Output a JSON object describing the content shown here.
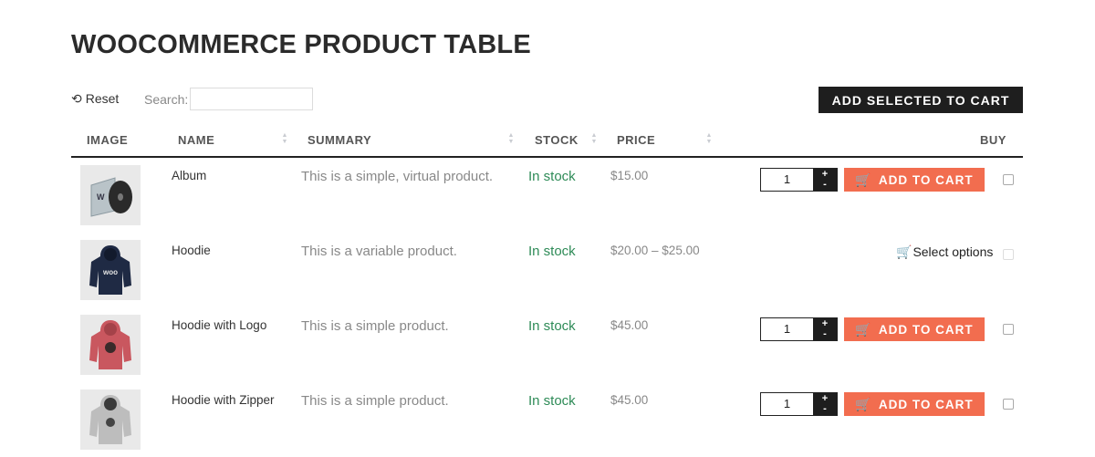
{
  "page": {
    "title": "WOOCOMMERCE PRODUCT TABLE"
  },
  "toolbar": {
    "reset_icon": "⟲",
    "reset_label": "Reset",
    "search_label": "Search:",
    "search_value": "",
    "add_selected_label": "ADD SELECTED TO CART"
  },
  "table": {
    "headers": {
      "image": "IMAGE",
      "name": "NAME",
      "summary": "SUMMARY",
      "stock": "STOCK",
      "price": "PRICE",
      "buy": "BUY"
    },
    "sort_icon": "sort-arrows-icon",
    "rows": [
      {
        "image": "album-cd-image",
        "name": "Album",
        "summary": "This is a simple, virtual product.",
        "stock": "In stock",
        "price": "$15.00",
        "qty": "1",
        "action": "ADD TO CART"
      },
      {
        "image": "hoodie-navy-image",
        "name": "Hoodie",
        "summary": "This is a variable product.",
        "stock": "In stock",
        "price": "$20.00 – $25.00",
        "action": "Select options"
      },
      {
        "image": "hoodie-logo-red-image",
        "name": "Hoodie with Logo",
        "summary": "This is a simple product.",
        "stock": "In stock",
        "price": "$45.00",
        "qty": "1",
        "action": "ADD TO CART"
      },
      {
        "image": "hoodie-zipper-grey-image",
        "name": "Hoodie with Zipper",
        "summary": "This is a simple product.",
        "stock": "In stock",
        "price": "$45.00",
        "qty": "1",
        "action": "ADD TO CART"
      }
    ]
  },
  "colors": {
    "accent": "#f26d4f",
    "dark_button": "#1e1e1e",
    "stock_green": "#2e8b57"
  }
}
